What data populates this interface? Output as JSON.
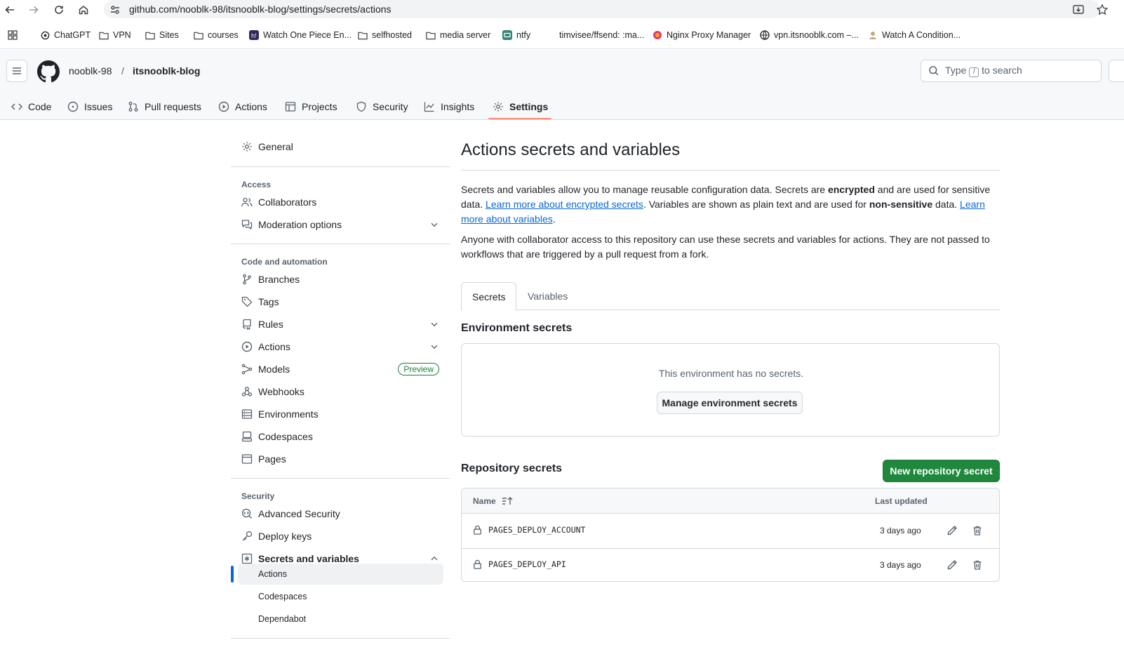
{
  "browser": {
    "url": "github.com/nooblk-98/itsnooblk-blog/settings/secrets/actions",
    "bookmarks": [
      {
        "label": "ChatGPT",
        "icon": "chatgpt-icon"
      },
      {
        "label": "VPN",
        "icon": "folder-icon"
      },
      {
        "label": "Sites",
        "icon": "folder-icon"
      },
      {
        "label": "courses",
        "icon": "folder-icon"
      },
      {
        "label": "Watch One Piece En...",
        "icon": "hianime-icon"
      },
      {
        "label": "selfhosted",
        "icon": "folder-icon"
      },
      {
        "label": "media server",
        "icon": "folder-icon"
      },
      {
        "label": "ntfy",
        "icon": "ntfy-icon"
      },
      {
        "label": "timvisee/ffsend: :ma...",
        "icon": "github-icon"
      },
      {
        "label": "Nginx Proxy Manager",
        "icon": "npm-icon"
      },
      {
        "label": "vpn.itsnooblk.com –...",
        "icon": "globe-icon"
      },
      {
        "label": "Watch A Condition...",
        "icon": "site-icon"
      }
    ]
  },
  "header": {
    "owner": "nooblk-98",
    "separator": "/",
    "repo": "itsnooblk-blog",
    "search": {
      "before": "Type",
      "key": "/",
      "after": "to search"
    },
    "tabs": [
      {
        "label": "Code",
        "icon": "code-icon"
      },
      {
        "label": "Issues",
        "icon": "issue-icon"
      },
      {
        "label": "Pull requests",
        "icon": "pull-request-icon"
      },
      {
        "label": "Actions",
        "icon": "play-icon"
      },
      {
        "label": "Projects",
        "icon": "table-icon"
      },
      {
        "label": "Security",
        "icon": "shield-icon"
      },
      {
        "label": "Insights",
        "icon": "graph-icon"
      },
      {
        "label": "Settings",
        "icon": "gear-icon",
        "active": true
      }
    ]
  },
  "sidebar": {
    "general": "General",
    "access_heading": "Access",
    "collaborators": "Collaborators",
    "moderation": "Moderation options",
    "code_heading": "Code and automation",
    "branches": "Branches",
    "tags": "Tags",
    "rules": "Rules",
    "actions": "Actions",
    "models": "Models",
    "preview": "Preview",
    "webhooks": "Webhooks",
    "environments": "Environments",
    "codespaces": "Codespaces",
    "pages": "Pages",
    "security_heading": "Security",
    "advanced_security": "Advanced Security",
    "deploy_keys": "Deploy keys",
    "secrets_variables": "Secrets and variables",
    "sub_actions": "Actions",
    "sub_codespaces": "Codespaces",
    "sub_dependabot": "Dependabot"
  },
  "main": {
    "title": "Actions secrets and variables",
    "intro": {
      "t1": "Secrets and variables allow you to manage reusable configuration data. Secrets are ",
      "b1": "encrypted",
      "t2": " and are used for sensitive data. ",
      "link1": "Learn more about encrypted secrets",
      "t3": ". Variables are shown as plain text and are used for ",
      "b2": "non-sensitive",
      "t4": " data. ",
      "link2": "Learn more about variables",
      "t5": "."
    },
    "access_note": "Anyone with collaborator access to this repository can use these secrets and variables for actions. They are not passed to workflows that are triggered by a pull request from a fork.",
    "tabs": {
      "secrets": "Secrets",
      "variables": "Variables"
    },
    "env_heading": "Environment secrets",
    "env_empty": "This environment has no secrets.",
    "env_button": "Manage environment secrets",
    "repo_heading": "Repository secrets",
    "new_button": "New repository secret",
    "table": {
      "col_name": "Name",
      "col_updated": "Last updated",
      "rows": [
        {
          "name": "PAGES_DEPLOY_ACCOUNT",
          "updated": "3 days ago"
        },
        {
          "name": "PAGES_DEPLOY_API",
          "updated": "3 days ago"
        }
      ]
    }
  },
  "colors": {
    "primary_button": "#1f883d",
    "link": "#0969da",
    "tab_underline": "#fd8c73",
    "sidebar_active": "#0969da"
  }
}
